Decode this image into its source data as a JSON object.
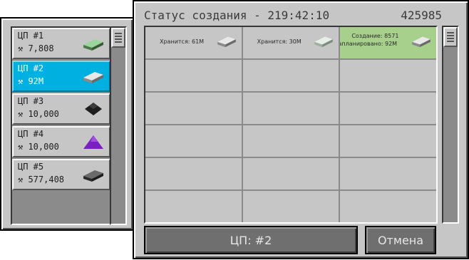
{
  "left_panel": {
    "items": [
      {
        "name": "ЦП #1",
        "value": "7,808",
        "icon": "green-ingot-icon",
        "selected": false
      },
      {
        "name": "ЦП #2",
        "value": "92M",
        "icon": "iron-ingot-icon",
        "selected": true
      },
      {
        "name": "ЦП #3",
        "value": "10,000",
        "icon": "coal-icon",
        "selected": false
      },
      {
        "name": "ЦП #4",
        "value": "10,000",
        "icon": "purple-dust-icon",
        "selected": false
      },
      {
        "name": "ЦП #5",
        "value": "577,408",
        "icon": "dark-ingot-icon",
        "selected": false
      }
    ]
  },
  "main": {
    "title": "Статус создания - 219:42:10",
    "counter": "425985",
    "cells": [
      {
        "line1": "Хранится: 61M",
        "line2": "",
        "icon": "iron-ingot-icon"
      },
      {
        "line1": "Хранится: 30M",
        "line2": "",
        "icon": "pale-ingot-icon"
      },
      {
        "line1": "Создание: 8571",
        "line2": "Запланировано: 92M",
        "icon": "iron-ingot-icon"
      }
    ],
    "cpu_button": "ЦП: #2",
    "cancel_button": "Отмена"
  },
  "colors": {
    "panel": "#c6c6c6",
    "selected": "#00b0e0",
    "crafting": "#a8d08d"
  }
}
